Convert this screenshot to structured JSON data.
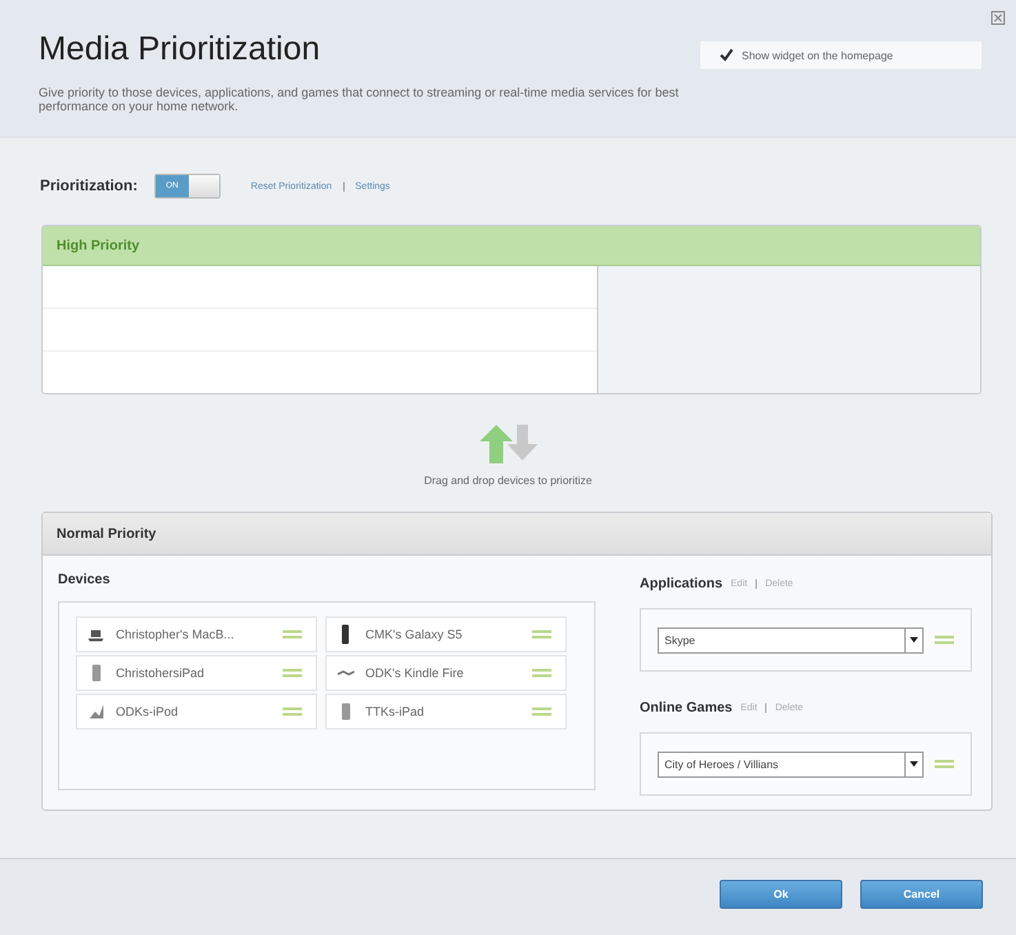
{
  "title": "Media Prioritization",
  "description": "Give priority to those devices, applications, and games that connect to streaming or real-time media services for best performance on your home network.",
  "widget_option": {
    "label": "Show widget on the homepage",
    "checked": true
  },
  "prioritization": {
    "label": "Prioritization:",
    "toggle": {
      "on": true,
      "text": "ON"
    },
    "links": [
      "Reset Prioritization",
      "Settings"
    ]
  },
  "high_priority": {
    "title": "High Priority"
  },
  "drag_hint": "Drag and drop devices to prioritize",
  "normal_priority": {
    "title": "Normal Priority",
    "devices": {
      "title": "Devices",
      "items": [
        {
          "name": "Christopher's MacB...",
          "kind": "laptop"
        },
        {
          "name": "CMK's Galaxy S5",
          "kind": "phone"
        },
        {
          "name": "ChristohersiPad",
          "kind": "tablet"
        },
        {
          "name": "ODK's Kindle Fire",
          "kind": "reader"
        },
        {
          "name": "ODKs-iPod",
          "kind": "player"
        },
        {
          "name": "TTKs-iPad",
          "kind": "tablet"
        }
      ]
    },
    "groups": [
      {
        "title": "Applications",
        "links": [
          "Edit",
          "Delete"
        ],
        "value": "Skype"
      },
      {
        "title": "Online Games",
        "links": [
          "Edit",
          "Delete"
        ],
        "value": "City of Heroes / Villians"
      }
    ]
  },
  "buttons": [
    "Ok",
    "Cancel"
  ]
}
